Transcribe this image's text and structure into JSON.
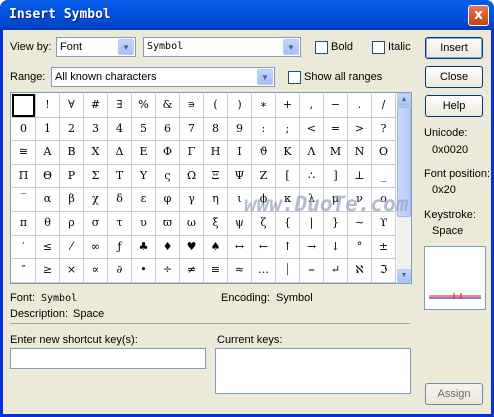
{
  "window": {
    "title": "Insert Symbol",
    "close_glyph": "x"
  },
  "toolbar": {
    "view_by_label": "View by:",
    "view_by_value": "Font",
    "font_value": "Symbol",
    "bold_label": "Bold",
    "italic_label": "Italic",
    "range_label": "Range:",
    "range_value": "All known characters",
    "show_all_ranges_label": "Show all ranges"
  },
  "buttons": {
    "insert": "Insert",
    "close": "Close",
    "help": "Help"
  },
  "symbol_grid": {
    "rows": [
      [
        "",
        "!",
        "∀",
        "#",
        "∃",
        "%",
        "&",
        "∍",
        "(",
        ")",
        "∗",
        "+",
        ",",
        "−",
        ".",
        "/"
      ],
      [
        "0",
        "1",
        "2",
        "3",
        "4",
        "5",
        "6",
        "7",
        "8",
        "9",
        ":",
        ";",
        "<",
        "=",
        ">",
        "?"
      ],
      [
        "≅",
        "Α",
        "Β",
        "Χ",
        "Δ",
        "Ε",
        "Φ",
        "Γ",
        "Η",
        "Ι",
        "ϑ",
        "Κ",
        "Λ",
        "Μ",
        "Ν",
        "Ο"
      ],
      [
        "Π",
        "Θ",
        "Ρ",
        "Σ",
        "Τ",
        "Υ",
        "ς",
        "Ω",
        "Ξ",
        "Ψ",
        "Ζ",
        "[",
        "∴",
        "]",
        "⊥",
        "_"
      ],
      [
        "‾",
        "α",
        "β",
        "χ",
        "δ",
        "ε",
        "φ",
        "γ",
        "η",
        "ι",
        "ϕ",
        "κ",
        "λ",
        "μ",
        "ν",
        "ο"
      ],
      [
        "π",
        "θ",
        "ρ",
        "σ",
        "τ",
        "υ",
        "ϖ",
        "ω",
        "ξ",
        "ψ",
        "ζ",
        "{",
        "|",
        "}",
        "∼",
        "ϒ"
      ],
      [
        "′",
        "≤",
        "⁄",
        "∞",
        "ƒ",
        "♣",
        "♦",
        "♥",
        "♠",
        "↔",
        "←",
        "↑",
        "→",
        "↓",
        "°",
        "±"
      ],
      [
        "″",
        "≥",
        "×",
        "∝",
        "∂",
        "•",
        "÷",
        "≠",
        "≡",
        "≈",
        "…",
        "⏐",
        "⎯",
        "↵",
        "ℵ",
        "ℑ"
      ]
    ]
  },
  "info": {
    "unicode_label": "Unicode:",
    "unicode_value": "0x0020",
    "font_position_label": "Font position:",
    "font_position_value": "0x20",
    "keystroke_label": "Keystroke:",
    "keystroke_value": "Space"
  },
  "status": {
    "font_label": "Font:",
    "font_value": "Symbol",
    "encoding_label": "Encoding:",
    "encoding_value": "Symbol",
    "description_label": "Description:",
    "description_value": "Space"
  },
  "shortcut": {
    "new_key_label": "Enter new shortcut key(s):",
    "new_key_value": "",
    "current_keys_label": "Current keys:",
    "assign_label": "Assign"
  },
  "watermark": {
    "text": "www.DuoTe.com"
  }
}
